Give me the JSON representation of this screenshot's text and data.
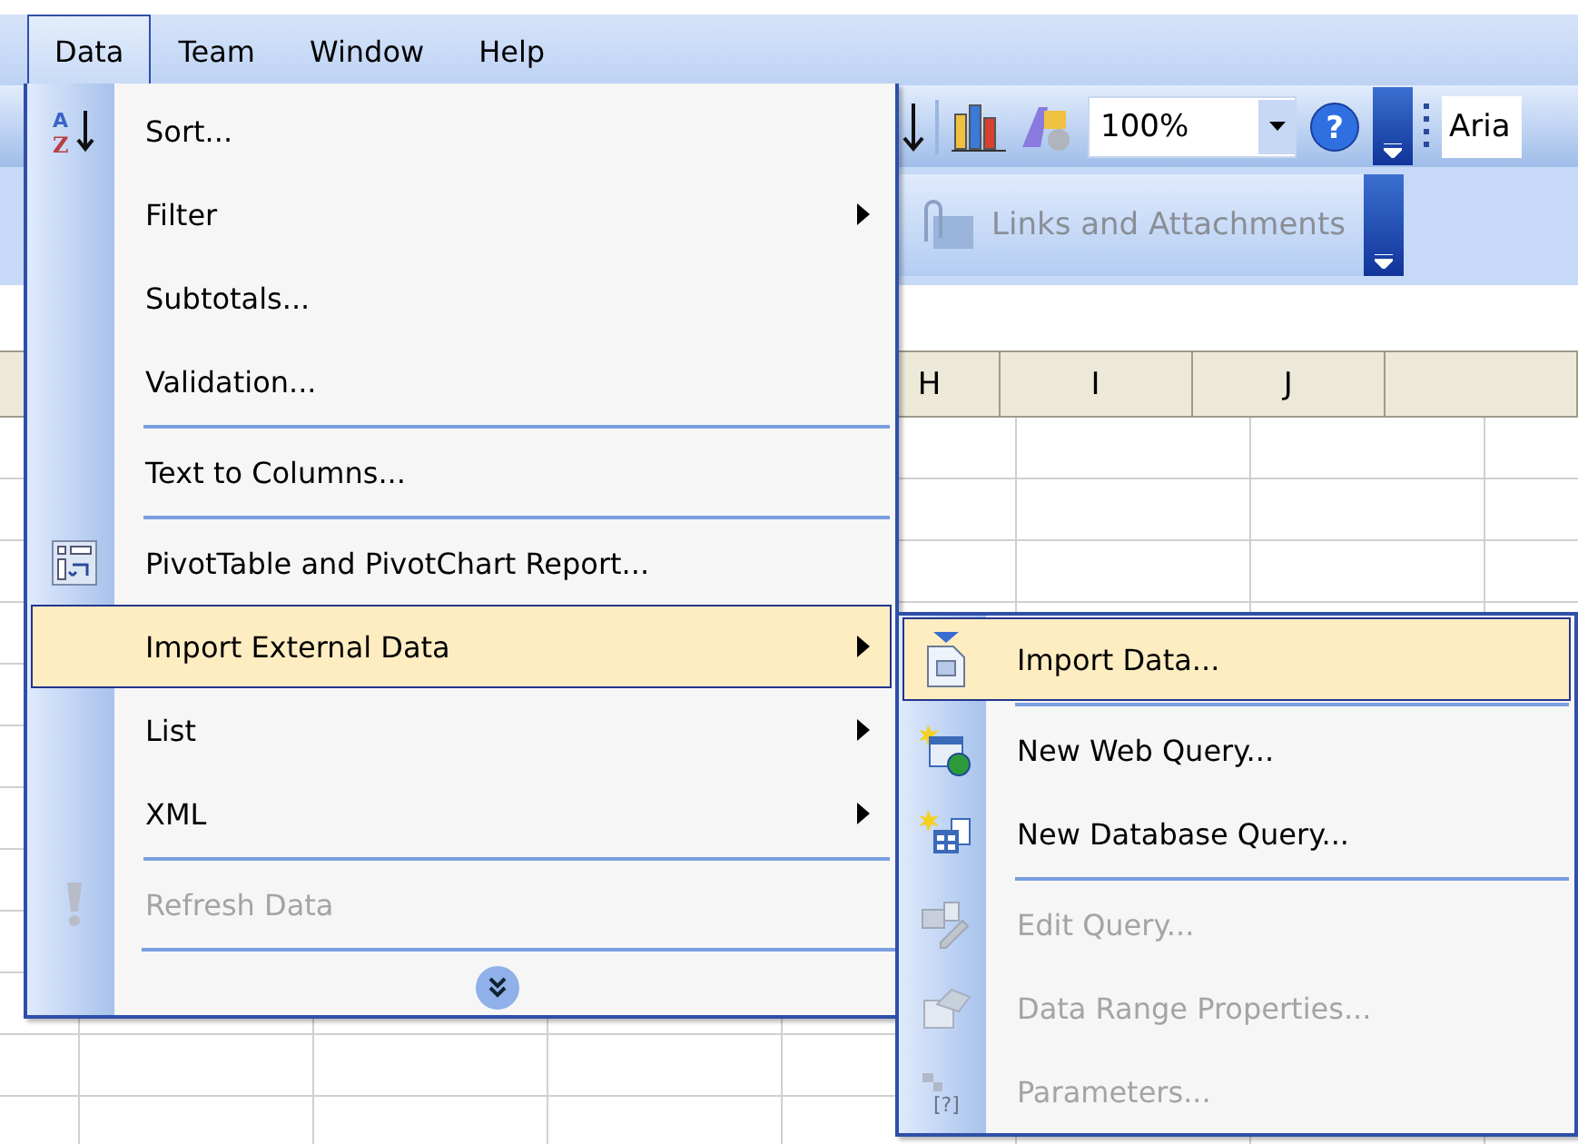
{
  "menu_bar": [
    {
      "label": "Data",
      "selected": true
    },
    {
      "label": "Team",
      "selected": false
    },
    {
      "label": "Window",
      "selected": false
    },
    {
      "label": "Help",
      "selected": false
    }
  ],
  "toolbar": {
    "zoom": "100%",
    "help": "?",
    "font": "Aria"
  },
  "toolbar_2": {
    "button": {
      "label": "Links and Attachments",
      "disabled": true
    }
  },
  "columns": [
    "H",
    "I",
    "J"
  ],
  "menu": {
    "items": [
      {
        "label": "Sort...",
        "icon_text": [
          "A",
          "Z"
        ],
        "submenu": false,
        "selected": false,
        "disabled": false,
        "separator_before": false
      },
      {
        "label": "Filter",
        "submenu": true,
        "selected": false,
        "disabled": false,
        "separator_before": false
      },
      {
        "label": "Subtotals...",
        "submenu": false,
        "selected": false,
        "disabled": false,
        "separator_before": false
      },
      {
        "label": "Validation...",
        "submenu": false,
        "selected": false,
        "disabled": false,
        "separator_before": false
      },
      {
        "label": "Text to Columns...",
        "submenu": false,
        "selected": false,
        "disabled": false,
        "separator_before": true
      },
      {
        "label": "PivotTable and PivotChart Report...",
        "submenu": false,
        "selected": false,
        "disabled": false,
        "separator_before": true
      },
      {
        "label": "Import External Data",
        "submenu": true,
        "selected": true,
        "disabled": false,
        "separator_before": false
      },
      {
        "label": "List",
        "submenu": true,
        "selected": false,
        "disabled": false,
        "separator_before": false
      },
      {
        "label": "XML",
        "submenu": true,
        "selected": false,
        "disabled": false,
        "separator_before": false
      },
      {
        "label": "Refresh Data",
        "submenu": false,
        "selected": false,
        "disabled": true,
        "separator_before": true
      }
    ],
    "expand": true
  },
  "submenu": {
    "items": [
      {
        "label": "Import Data...",
        "selected": true,
        "disabled": false,
        "separator_before": false
      },
      {
        "label": "New Web Query...",
        "selected": false,
        "disabled": false,
        "separator_before": true
      },
      {
        "label": "New Database Query...",
        "selected": false,
        "disabled": false,
        "separator_before": false
      },
      {
        "label": "Edit Query...",
        "selected": false,
        "disabled": true,
        "separator_before": true
      },
      {
        "label": "Data Range Properties...",
        "selected": false,
        "disabled": true,
        "separator_before": false
      },
      {
        "label": "Parameters...",
        "icon_text": [
          "[?]"
        ],
        "selected": false,
        "disabled": true,
        "separator_before": false
      }
    ]
  }
}
